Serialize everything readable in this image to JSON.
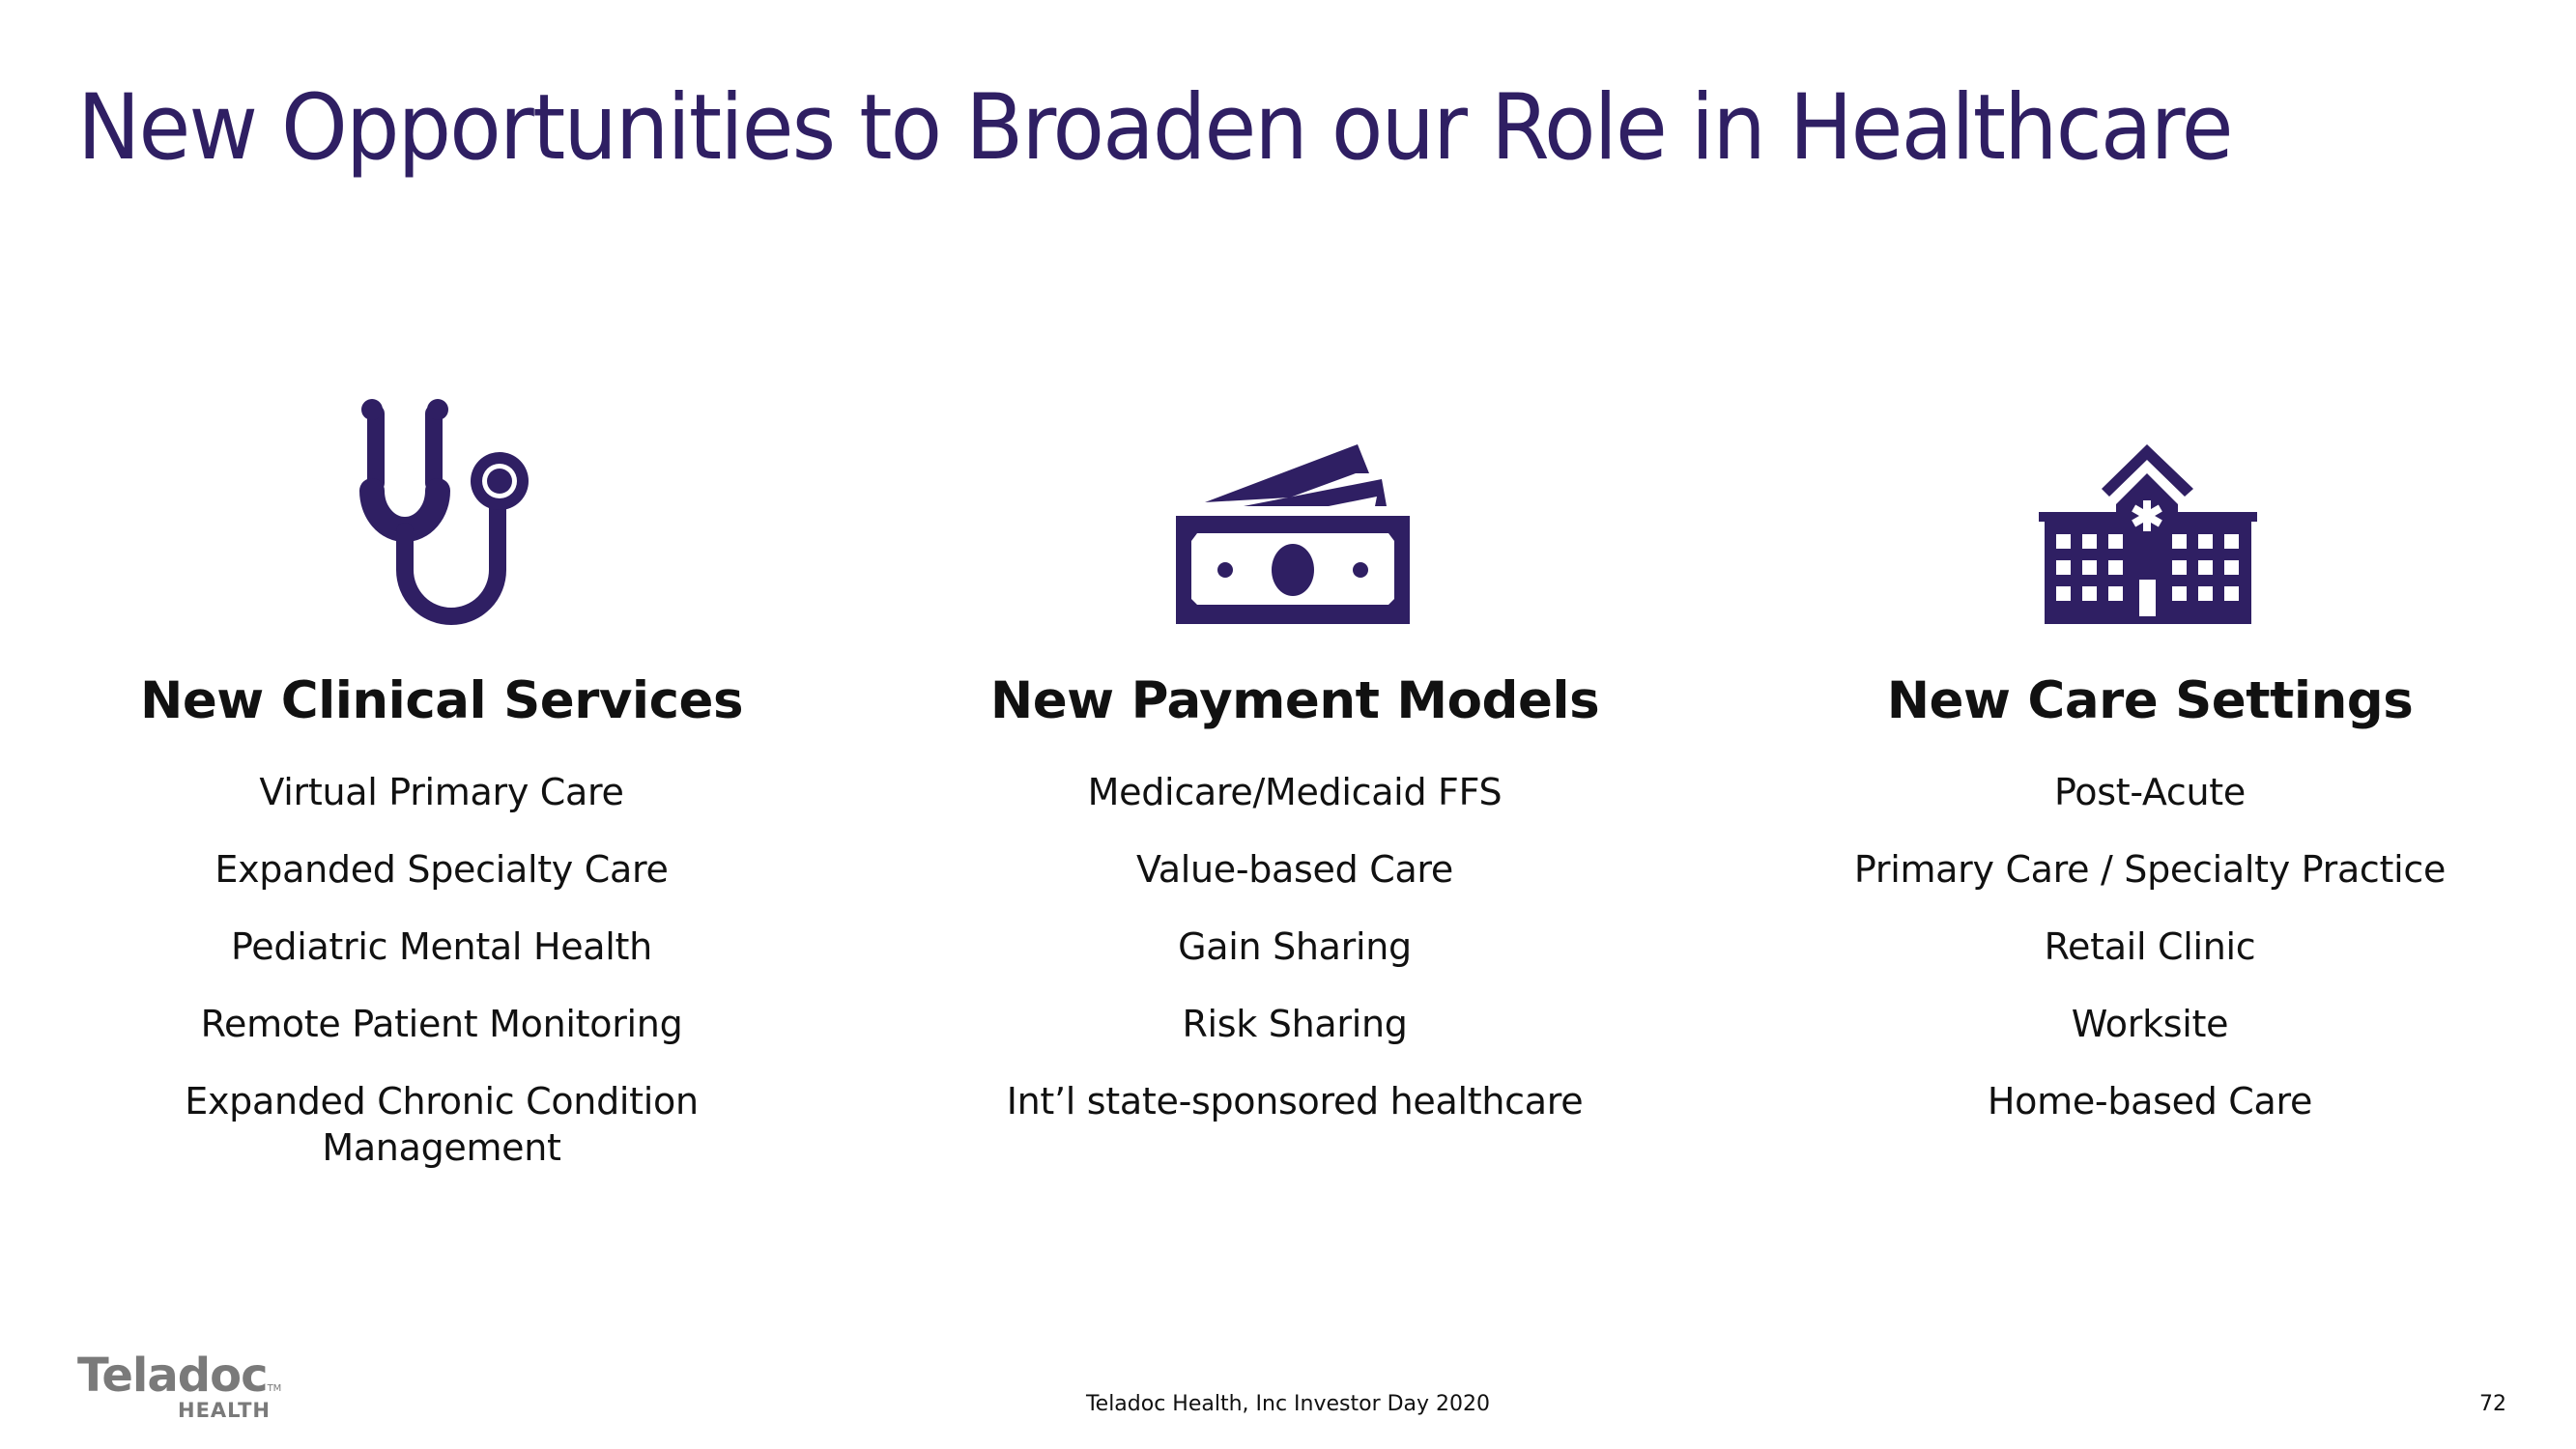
{
  "slide": {
    "title": "New Opportunities to Broaden our Role in Healthcare",
    "accent_color": "#2f1f63"
  },
  "columns": [
    {
      "icon": "stethoscope-icon",
      "heading": "New Clinical Services",
      "items": [
        "Virtual Primary Care",
        "Expanded Specialty Care",
        "Pediatric Mental Health",
        "Remote Patient Monitoring",
        "Expanded Chronic Condition Management"
      ]
    },
    {
      "icon": "money-bills-icon",
      "heading": "New Payment Models",
      "items": [
        "Medicare/Medicaid FFS",
        "Value-based Care",
        "Gain Sharing",
        "Risk Sharing",
        "Int’l state-sponsored healthcare"
      ]
    },
    {
      "icon": "hospital-icon",
      "heading": "New Care Settings",
      "items": [
        "Post-Acute",
        "Primary Care / Specialty Practice",
        "Retail Clinic",
        "Worksite",
        "Home-based Care"
      ]
    }
  ],
  "logo": {
    "word": "Teladoc",
    "tm": "TM",
    "sub": "HEALTH"
  },
  "footer": {
    "text": "Teladoc Health, Inc Investor Day 2020",
    "page_number": "72"
  }
}
